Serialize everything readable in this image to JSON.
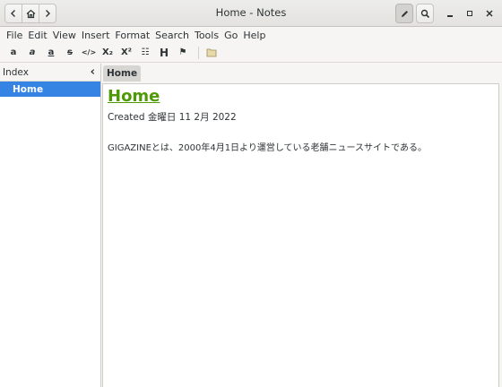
{
  "window": {
    "title": "Home - Notes"
  },
  "nav_buttons": {
    "back_icon": "chevron-left",
    "home_icon": "home",
    "forward_icon": "chevron-right"
  },
  "headerbar_actions": {
    "edit_icon": "pencil",
    "search_icon": "magnifier"
  },
  "menubar": [
    "File",
    "Edit",
    "View",
    "Insert",
    "Format",
    "Search",
    "Tools",
    "Go",
    "Help"
  ],
  "toolbar": {
    "strong": "a",
    "emphasis": "a",
    "mark": "a",
    "strike": "s",
    "verbatim": "</>",
    "subscript": "X₂",
    "superscript": "X²",
    "bullet_list": "☷",
    "heading": "H",
    "style": "⚑",
    "attach": "📁"
  },
  "sidebar": {
    "header_label": "Index",
    "collapse_glyph": "‹",
    "items": [
      {
        "label": "Home",
        "selected": true
      }
    ]
  },
  "tabs": [
    {
      "label": "Home"
    }
  ],
  "page": {
    "title": "Home",
    "created": "Created 金曜日 11 2月 2022",
    "body": "GIGAZINEとは、2000年4月1日より運営している老舗ニュースサイトである。"
  },
  "colors": {
    "accent": "#3584e4",
    "title_link": "#4e9a06"
  }
}
